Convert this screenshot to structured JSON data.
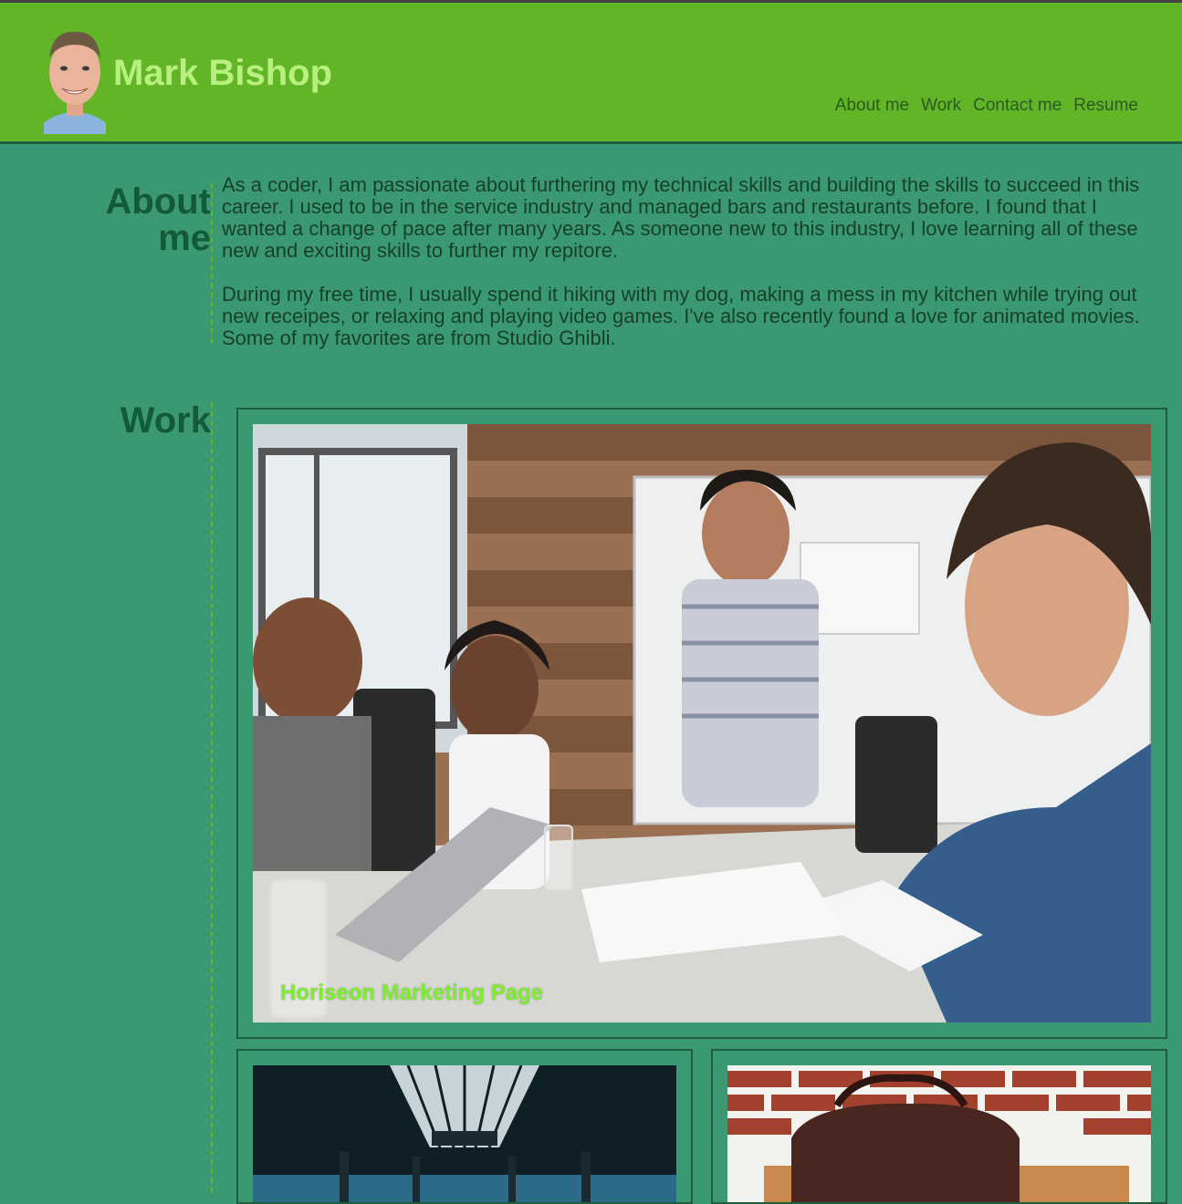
{
  "header": {
    "title": "Mark Bishop",
    "nav": [
      "About me",
      "Work",
      "Contact me",
      "Resume"
    ]
  },
  "about": {
    "heading_line1": "About",
    "heading_line2": "me",
    "paragraphs": [
      "As a coder, I am passionate about furthering my technical skills and building the skills to succeed in this career. I used to be in the service industry and managed bars and restaurants before. I found that I wanted a change of pace after many years. As someone new to this industry, I love learning all of these new and exciting skills to further my repitore.",
      "During my free time, I usually spend it hiking with my dog, making a mess in my kitchen while trying out new receipes, or relaxing and playing video games. I've also recently found a love for animated movies. Some of my favorites are from Studio Ghibli."
    ]
  },
  "work": {
    "heading": "Work",
    "featured": {
      "caption": "Horiseon Marketing Page"
    }
  },
  "colors": {
    "page_bg": "#3a9973",
    "header_bg": "#62b526",
    "title": "#b7f07e",
    "heading": "#135a36",
    "caption": "#7dee2c"
  }
}
